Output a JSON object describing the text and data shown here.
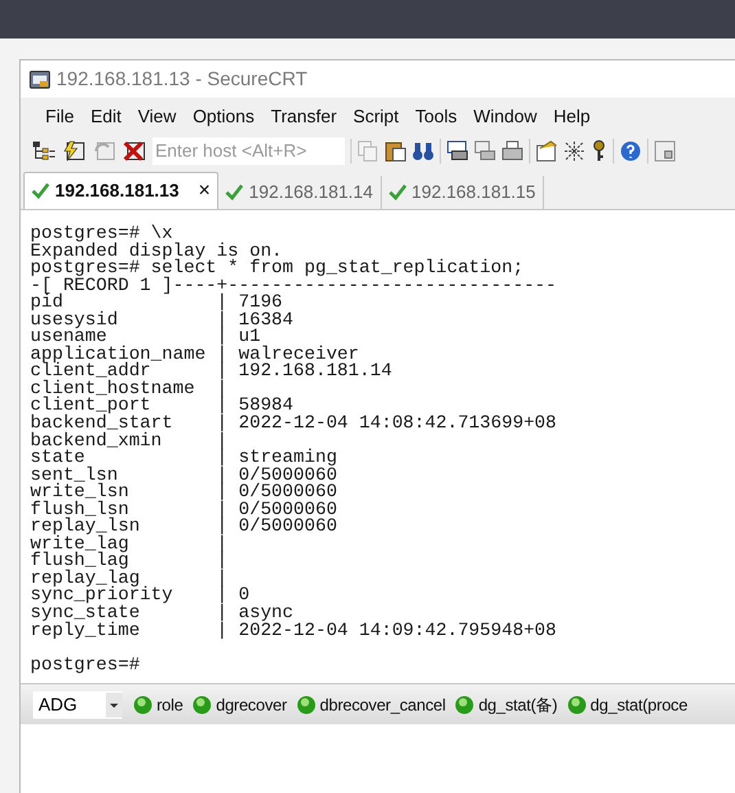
{
  "window": {
    "title": "192.168.181.13 - SecureCRT"
  },
  "menu": [
    "File",
    "Edit",
    "View",
    "Options",
    "Transfer",
    "Script",
    "Tools",
    "Window",
    "Help"
  ],
  "toolbar": {
    "host_placeholder": "Enter host <Alt+R>"
  },
  "tabs": [
    {
      "label": "192.168.181.13",
      "selected": true,
      "close": "×"
    },
    {
      "label": "192.168.181.14",
      "selected": false
    },
    {
      "label": "192.168.181.15",
      "selected": false
    }
  ],
  "terminal": {
    "lines": [
      "postgres=# \\x",
      "Expanded display is on.",
      "postgres=# select * from pg_stat_replication;",
      "-[ RECORD 1 ]----+------------------------------",
      "pid              | 7196",
      "usesysid         | 16384",
      "usename          | u1",
      "application_name | walreceiver",
      "client_addr      | 192.168.181.14",
      "client_hostname  | ",
      "client_port      | 58984",
      "backend_start    | 2022-12-04 14:08:42.713699+08",
      "backend_xmin     | ",
      "state            | streaming",
      "sent_lsn         | 0/5000060",
      "write_lsn        | 0/5000060",
      "flush_lsn        | 0/5000060",
      "replay_lsn       | 0/5000060",
      "write_lag        | ",
      "flush_lag        | ",
      "replay_lag       | ",
      "sync_priority    | 0",
      "sync_state       | async",
      "reply_time       | 2022-12-04 14:09:42.795948+08"
    ],
    "prompt": "postgres=#"
  },
  "button_bar": {
    "dropdown": "ADG",
    "buttons": [
      "role",
      "dgrecover",
      "dbrecover_cancel",
      "dg_stat(备)",
      "dg_stat(proce"
    ]
  }
}
